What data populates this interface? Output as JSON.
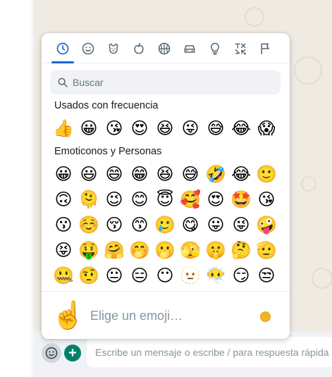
{
  "composer": {
    "placeholder": "Escribe un mensaje o escribe / para respuesta rápida",
    "plus_label": "+"
  },
  "search": {
    "placeholder": "Buscar"
  },
  "sections": {
    "frequent": {
      "title": "Usados con frecuencia",
      "emojis": [
        "👍",
        "😀",
        "😘",
        "😍",
        "😆",
        "😜",
        "😅",
        "😂",
        "😱"
      ]
    },
    "smileys": {
      "title": "Emoticonos y Personas",
      "emojis": [
        "😀",
        "😃",
        "😄",
        "😁",
        "😆",
        "😅",
        "🤣",
        "😂",
        "🙂",
        "🙃",
        "🫠",
        "😉",
        "😊",
        "😇",
        "🥰",
        "😍",
        "🤩",
        "😘",
        "😗",
        "☺️",
        "😚",
        "😙",
        "🥲",
        "😋",
        "😛",
        "😜",
        "🤪",
        "😝",
        "🤑",
        "🤗",
        "🤭",
        "🫢",
        "🫣",
        "🤫",
        "🤔",
        "🫡",
        "🤐",
        "🤨",
        "😐",
        "😑",
        "😶",
        "🫥",
        "😶‍🌫️",
        "😏",
        "😒"
      ]
    }
  },
  "footer": {
    "preview_emoji": "☝️",
    "hint": "Elige un emoji…"
  },
  "colors": {
    "accent": "#1a64d6",
    "tab_icon": "#54656f",
    "brand_green": "#008069",
    "chat_background": "#efeae2"
  },
  "tabs": [
    {
      "icon": "clock-icon",
      "active": true
    },
    {
      "icon": "smiley-icon",
      "active": false
    },
    {
      "icon": "animal-icon",
      "active": false
    },
    {
      "icon": "food-icon",
      "active": false
    },
    {
      "icon": "activity-icon",
      "active": false
    },
    {
      "icon": "car-icon",
      "active": false
    },
    {
      "icon": "lightbulb-icon",
      "active": false
    },
    {
      "icon": "symbols-icon",
      "active": false
    },
    {
      "icon": "flag-icon",
      "active": false
    }
  ]
}
